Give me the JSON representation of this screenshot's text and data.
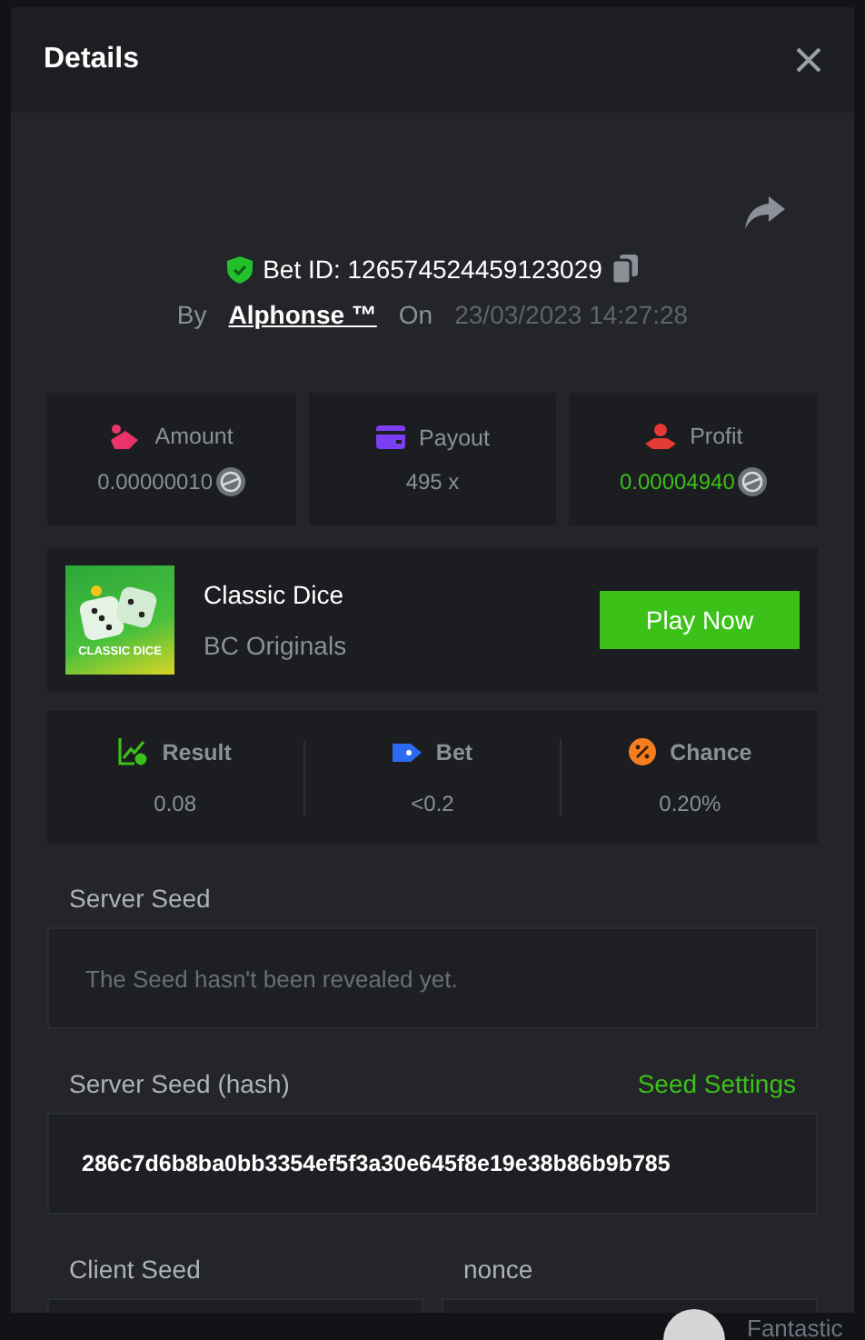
{
  "window": {
    "title": "Details"
  },
  "bet": {
    "id_label": "Bet ID: 126574524459123029",
    "by_label": "By",
    "user": "Alphonse ™",
    "on_label": "On",
    "date": "23/03/2023 14:27:28"
  },
  "stats": [
    {
      "label": "Amount",
      "value": "0.00000010",
      "kind": "amount",
      "coin": true
    },
    {
      "label": "Payout",
      "value": "495 x",
      "kind": "payout",
      "coin": false
    },
    {
      "label": "Profit",
      "value": "0.00004940",
      "kind": "profit",
      "coin": true
    }
  ],
  "game": {
    "name": "Classic Dice",
    "provider": "BC Originals",
    "thumb_text": "CLASSIC DICE",
    "button": "Play Now"
  },
  "results": [
    {
      "label": "Result",
      "value": "0.08",
      "kind": "result"
    },
    {
      "label": "Bet",
      "value": "<0.2",
      "kind": "bet"
    },
    {
      "label": "Chance",
      "value": "0.20%",
      "kind": "chance"
    }
  ],
  "server_seed": {
    "label": "Server Seed",
    "placeholder": "The Seed hasn't been revealed yet."
  },
  "server_seed_hash": {
    "label": "Server Seed (hash)",
    "link": "Seed Settings",
    "value": "286c7d6b8ba0bb3354ef5f3a30e645f8e19e38b86b9b785"
  },
  "client_seed": {
    "label": "Client Seed"
  },
  "nonce": {
    "label": "nonce"
  },
  "background": {
    "user_name": "Fantastic"
  }
}
